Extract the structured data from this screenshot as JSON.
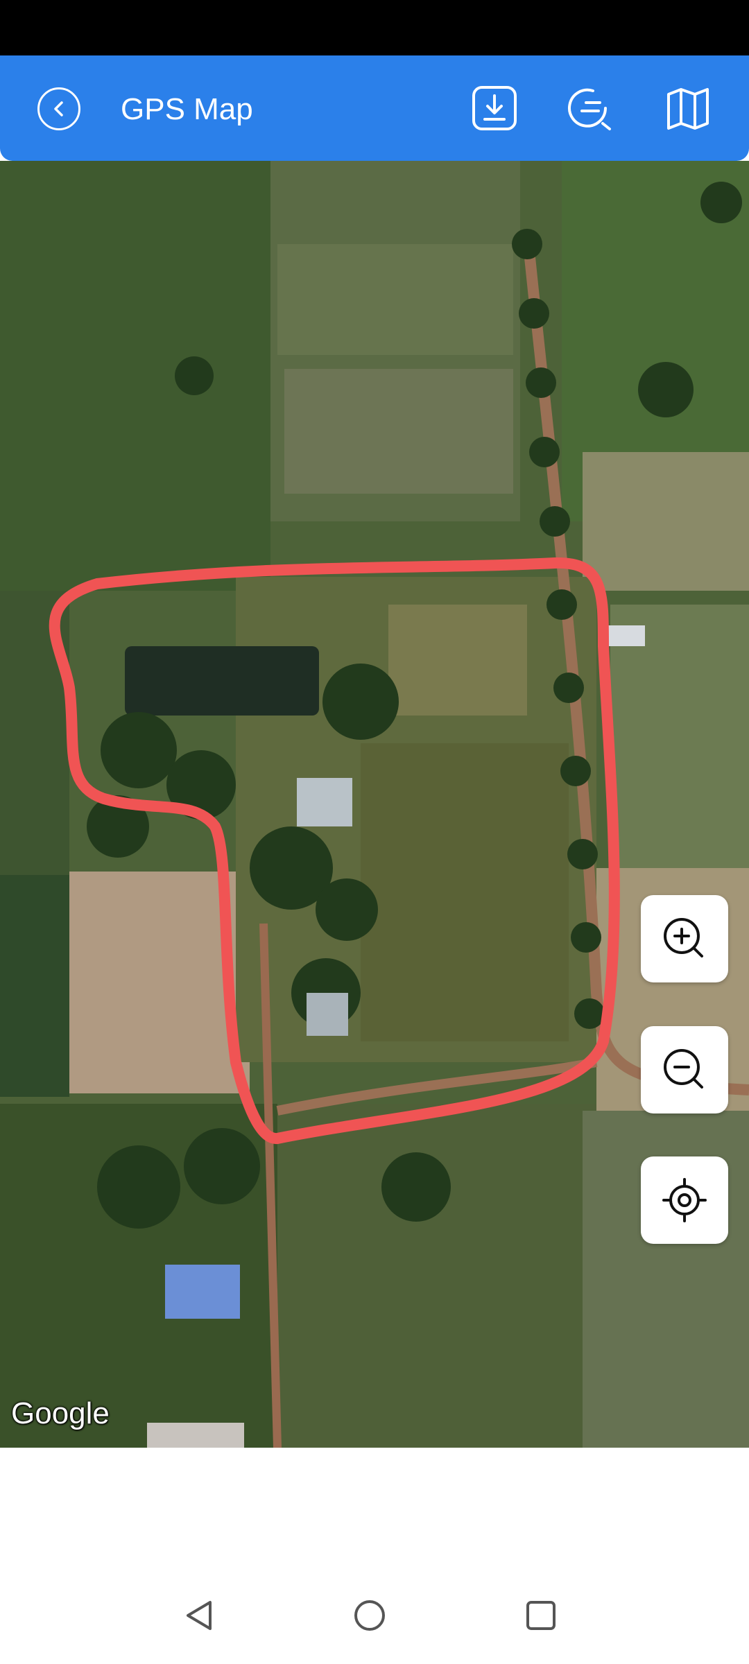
{
  "app_bar": {
    "title": "GPS Map",
    "color": "#2b80ea",
    "icons": [
      "back-icon",
      "download-icon",
      "search-map-icon",
      "map-icon"
    ]
  },
  "map": {
    "attribution": "Google",
    "view": "satellite",
    "boundary_color": "#f05454"
  },
  "map_controls": [
    "zoom-in-icon",
    "zoom-out-icon",
    "locate-icon"
  ],
  "nav_bar": [
    "nav-back-icon",
    "nav-home-icon",
    "nav-recents-icon"
  ]
}
